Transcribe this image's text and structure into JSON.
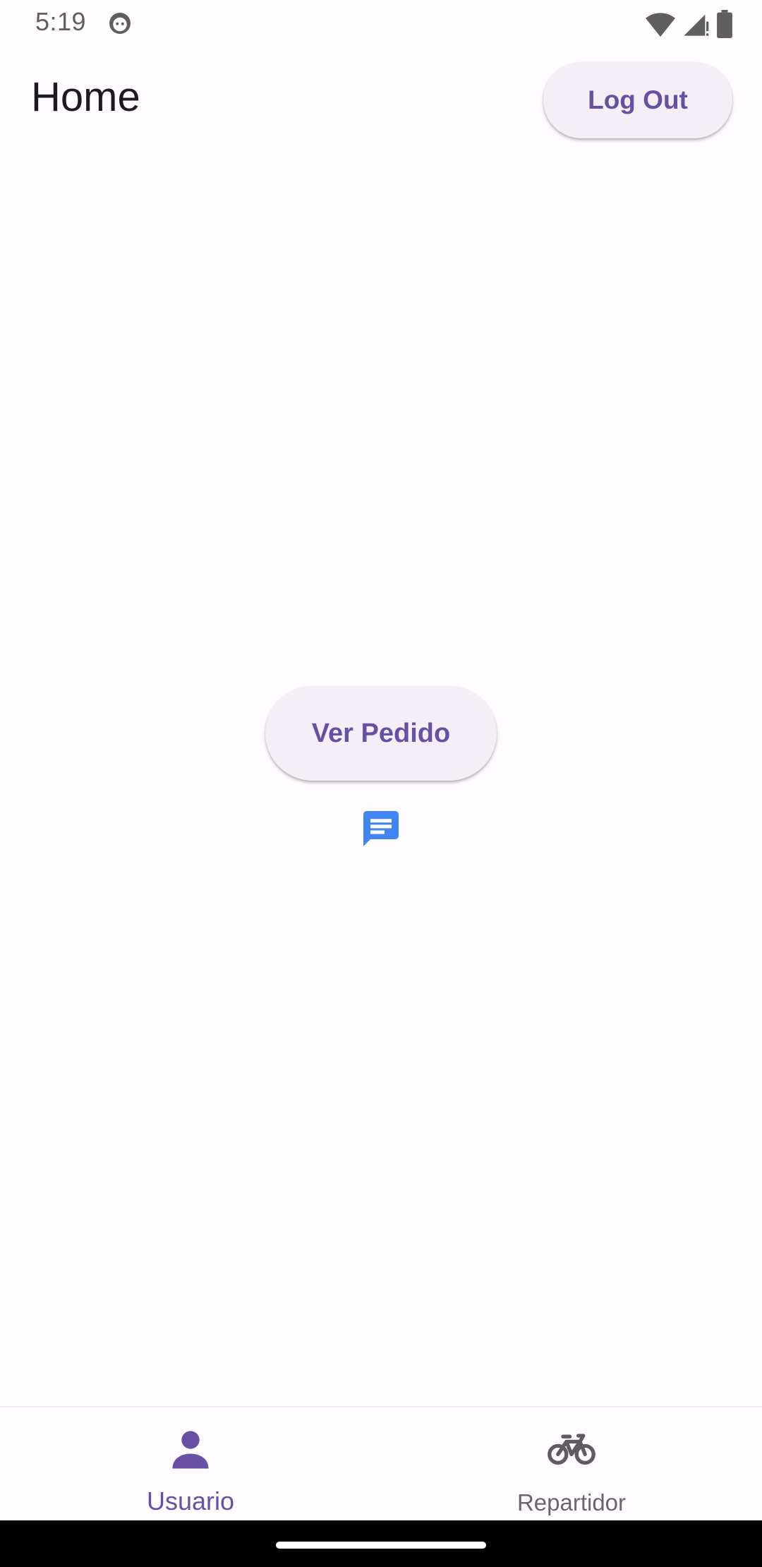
{
  "status_bar": {
    "time": "5:19"
  },
  "app_bar": {
    "title": "Home",
    "logout_label": "Log Out"
  },
  "main": {
    "ver_pedido_label": "Ver Pedido"
  },
  "bottom_nav": {
    "items": [
      {
        "label": "Usuario",
        "icon": "person-icon",
        "active": true
      },
      {
        "label": "Repartidor",
        "icon": "bicycle-icon",
        "active": false
      }
    ]
  },
  "colors": {
    "accent": "#6750a4",
    "button_bg": "#f4eff7",
    "background": "#fffbfe",
    "chat_icon": "#4285f4"
  }
}
